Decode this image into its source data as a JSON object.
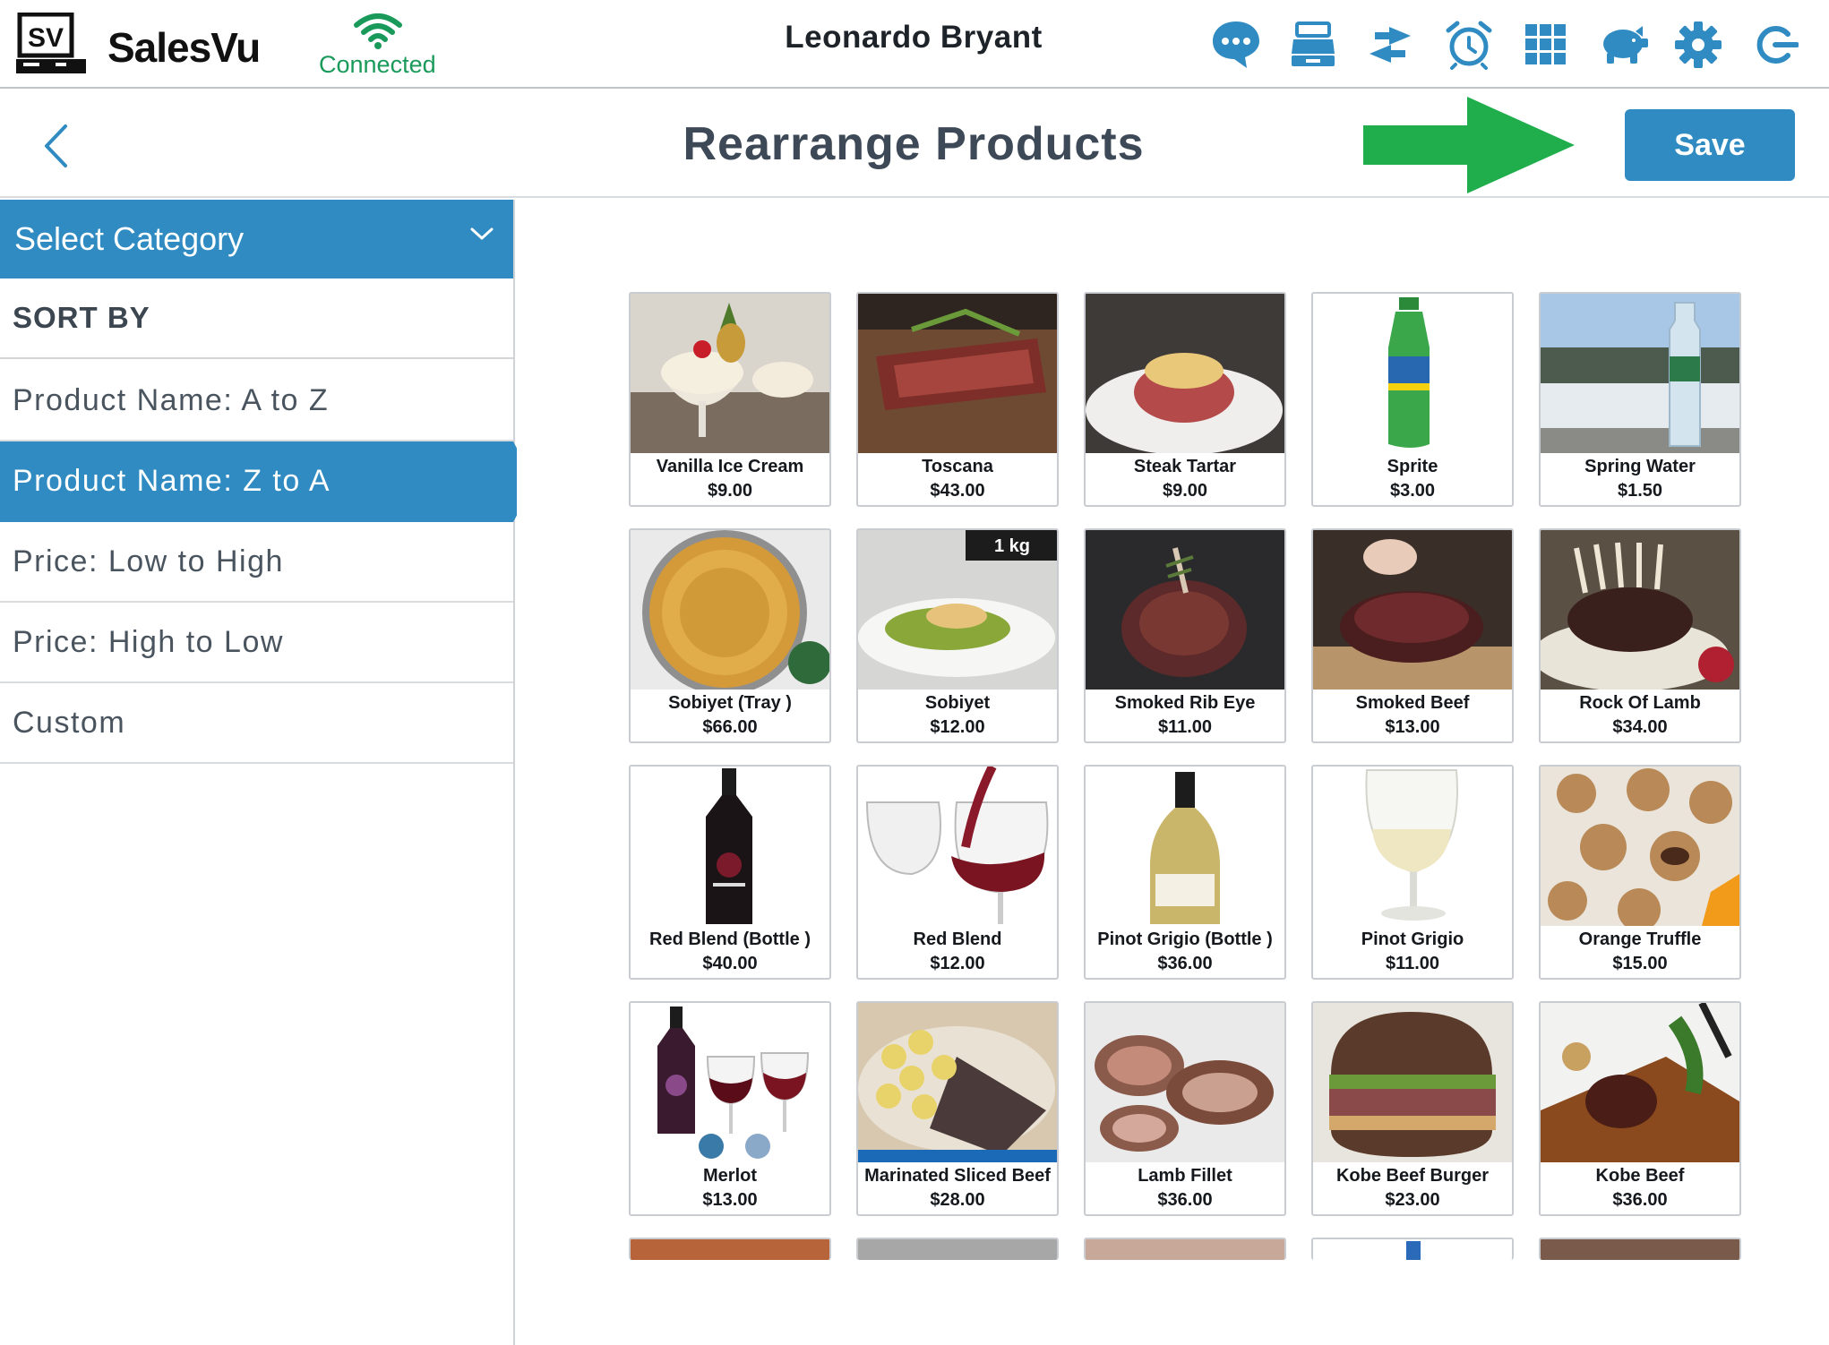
{
  "header": {
    "brand": "SalesVu",
    "logo_text": "SV",
    "connection_status": "Connected",
    "user_name": "Leonardo Bryant",
    "icons": [
      "chat-icon",
      "cash-register-icon",
      "transfer-arrows-icon",
      "alarm-clock-icon",
      "grid-apps-icon",
      "piggy-bank-icon",
      "gear-icon",
      "logout-icon"
    ]
  },
  "titlebar": {
    "title": "Rearrange Products",
    "save_label": "Save"
  },
  "sidebar": {
    "category_label": "Select Category",
    "sort_title": "SORT BY",
    "sort_options": [
      "Product Name: A to Z",
      "Product Name: Z to A",
      "Price: Low to High",
      "Price: High to Low",
      "Custom"
    ],
    "active_sort": "Product Name: Z to A"
  },
  "products": [
    {
      "name": "Vanilla Ice Cream",
      "price": "$9.00"
    },
    {
      "name": "Toscana",
      "price": "$43.00"
    },
    {
      "name": "Steak Tartar",
      "price": "$9.00"
    },
    {
      "name": "Sprite",
      "price": "$3.00"
    },
    {
      "name": "Spring Water",
      "price": "$1.50"
    },
    {
      "name": "Sobiyet (Tray )",
      "price": "$66.00"
    },
    {
      "name": "Sobiyet",
      "price": "$12.00",
      "badge": "1 kg"
    },
    {
      "name": "Smoked Rib Eye",
      "price": "$11.00"
    },
    {
      "name": "Smoked Beef",
      "price": "$13.00"
    },
    {
      "name": "Rock Of Lamb",
      "price": "$34.00"
    },
    {
      "name": "Red Blend (Bottle )",
      "price": "$40.00"
    },
    {
      "name": "Red Blend",
      "price": "$12.00"
    },
    {
      "name": "Pinot Grigio (Bottle )",
      "price": "$36.00"
    },
    {
      "name": "Pinot Grigio",
      "price": "$11.00"
    },
    {
      "name": "Orange Truffle",
      "price": "$15.00"
    },
    {
      "name": "Merlot",
      "price": "$13.00"
    },
    {
      "name": "Marinated Sliced Beef",
      "price": "$28.00"
    },
    {
      "name": "Lamb Fillet",
      "price": "$36.00"
    },
    {
      "name": "Kobe Beef  Burger",
      "price": "$23.00"
    },
    {
      "name": "Kobe Beef",
      "price": "$36.00"
    }
  ],
  "colors": {
    "accent": "#2f8bc2",
    "connected": "#1a9a5a",
    "arrow": "#1fae4b",
    "header_icon": "#2f8bc2"
  }
}
